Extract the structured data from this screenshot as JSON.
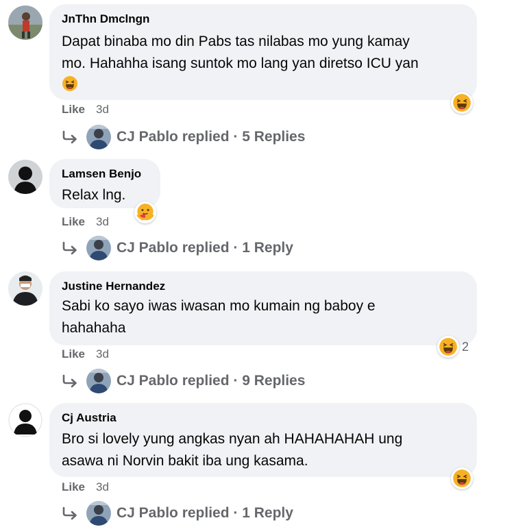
{
  "comments": [
    {
      "author": "JnThn Dmclngn",
      "lines": [
        "Dapat binaba mo din Pabs tas nilabas mo yung kamay",
        "mo. Hahahha isang suntok mo lang yan diretso ICU yan"
      ],
      "like": "Like",
      "time": "3d",
      "reaction": "haha-icon",
      "reaction_count": "",
      "reply_text": "CJ Pablo replied · 5 Replies"
    },
    {
      "author": "Lamsen Benjo",
      "lines": [
        "Relax lng."
      ],
      "like": "Like",
      "time": "3d",
      "reaction": "care-icon",
      "reaction_count": "",
      "reply_text": "CJ Pablo replied · 1 Reply"
    },
    {
      "author": "Justine Hernandez",
      "lines": [
        "Sabi ko sayo iwas iwasan mo kumain ng baboy e",
        "hahahaha"
      ],
      "like": "Like",
      "time": "3d",
      "reaction": "haha-icon",
      "reaction_count": "2",
      "reply_text": "CJ Pablo replied · 9 Replies"
    },
    {
      "author": "Cj Austria",
      "lines": [
        "Bro si lovely yung angkas nyan ah HAHAHAHAH ung",
        "asawa ni Norvin bakit iba ung kasama."
      ],
      "like": "Like",
      "time": "3d",
      "reaction": "haha-icon",
      "reaction_count": "",
      "reply_text": "CJ Pablo replied · 1 Reply"
    }
  ],
  "colors": {
    "bubble": "#f0f2f5",
    "meta": "#65676b",
    "haha": "#f7b125"
  }
}
